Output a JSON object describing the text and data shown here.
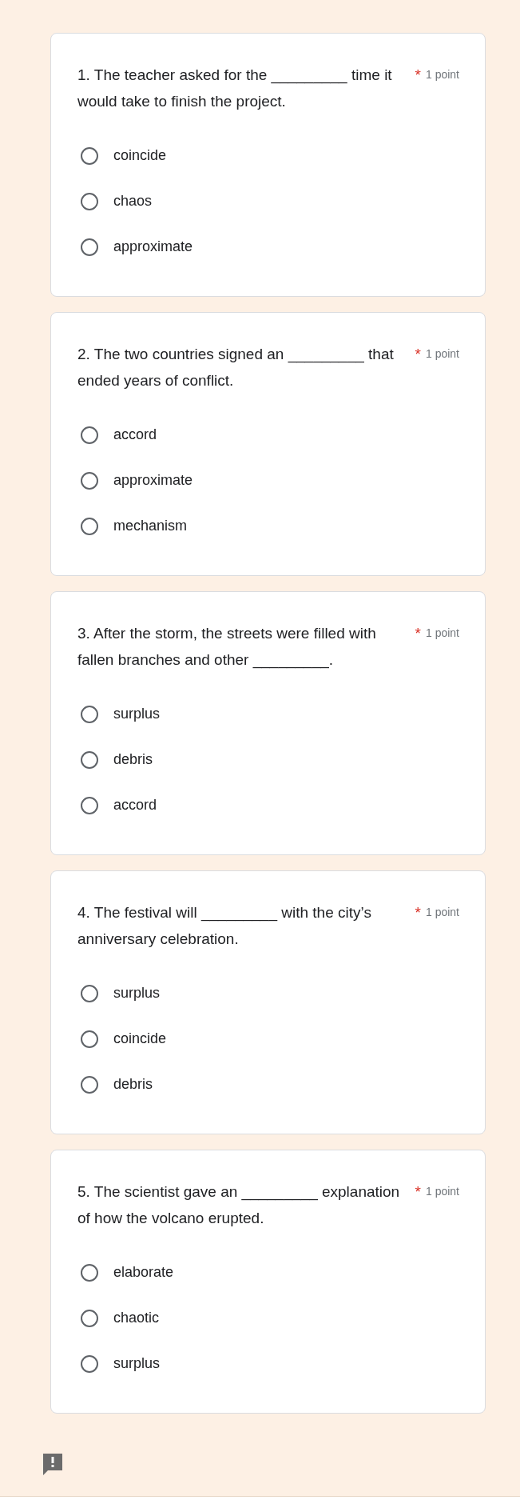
{
  "questions": [
    {
      "text": "1. The teacher asked for the _________ time it would take to finish the project.",
      "required_mark": "*",
      "points": "1 point",
      "options": [
        {
          "label": "coincide",
          "selected": false
        },
        {
          "label": "chaos",
          "selected": false
        },
        {
          "label": "approximate",
          "selected": false
        }
      ]
    },
    {
      "text": "2. The two countries signed an _________ that ended years of conflict.",
      "required_mark": "*",
      "points": "1 point",
      "options": [
        {
          "label": "accord",
          "selected": false
        },
        {
          "label": "approximate",
          "selected": false
        },
        {
          "label": "mechanism",
          "selected": false
        }
      ]
    },
    {
      "text": "3. After the storm, the streets were filled with fallen branches and other _________.",
      "required_mark": "*",
      "points": "1 point",
      "options": [
        {
          "label": "surplus",
          "selected": false
        },
        {
          "label": "debris",
          "selected": false
        },
        {
          "label": "accord",
          "selected": false
        }
      ]
    },
    {
      "text": "4.  The festival will _________ with the city’s anniversary celebration.",
      "required_mark": "*",
      "points": "1 point",
      "options": [
        {
          "label": "surplus",
          "selected": false
        },
        {
          "label": "coincide",
          "selected": false
        },
        {
          "label": "debris",
          "selected": false
        }
      ]
    },
    {
      "text": "5. The scientist gave an _________ explanation of how the volcano erupted.",
      "required_mark": "*",
      "points": "1 point",
      "options": [
        {
          "label": "elaborate",
          "selected": false
        },
        {
          "label": "chaotic",
          "selected": false
        },
        {
          "label": "surplus",
          "selected": false
        }
      ]
    }
  ]
}
